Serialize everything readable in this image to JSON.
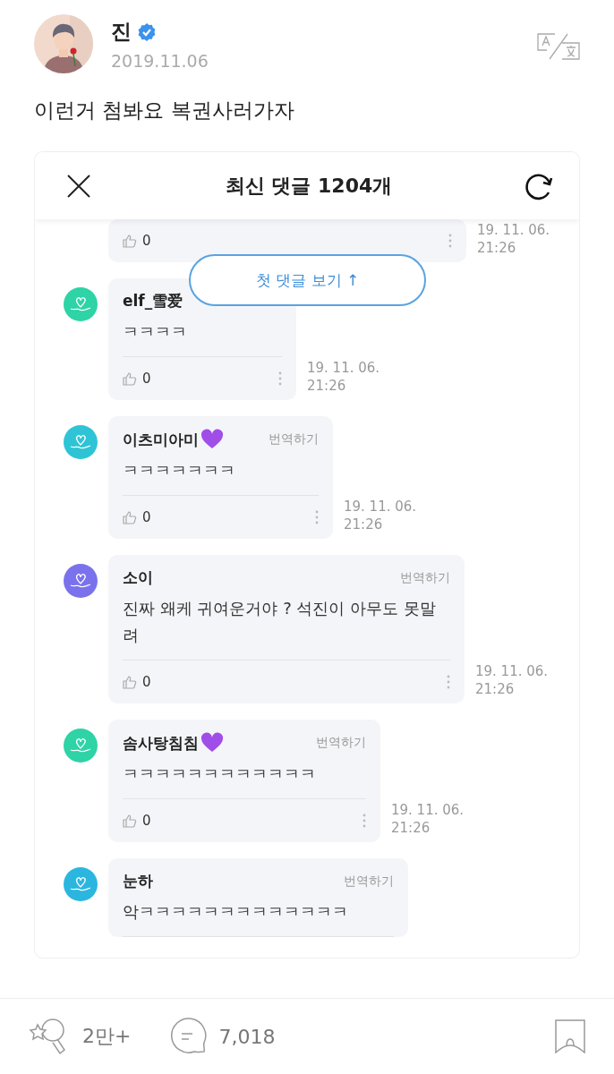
{
  "post": {
    "author": "진",
    "verified": true,
    "date": "2019.11.06",
    "text": "이런거 첨봐요 복권사러가자"
  },
  "comments_panel": {
    "title": "최신 댓글 1204개",
    "first_comment_button": "첫 댓글 보기 ↑",
    "comments": [
      {
        "kind": "partial",
        "likes": "0",
        "time": [
          "19. 11. 06.",
          "21:26"
        ]
      },
      {
        "kind": "full",
        "name": "elf_雪爱",
        "heart": false,
        "color": "#2ed3a6",
        "text": "ㅋㅋㅋㅋ",
        "likes": "0",
        "time": [
          "19. 11. 06.",
          "21:26"
        ]
      },
      {
        "kind": "full",
        "name": "이츠미아미",
        "heart": true,
        "color": "#2ec4d6",
        "translate": "번역하기",
        "text": "ㅋㅋㅋㅋㅋㅋㅋ",
        "likes": "0",
        "time": [
          "19. 11. 06.",
          "21:26"
        ]
      },
      {
        "kind": "full",
        "name": "소이",
        "heart": false,
        "color": "#7a72ec",
        "translate": "번역하기",
        "text": "진짜 왜케 귀여운거야 ? 석진이 아무도 못말려",
        "likes": "0",
        "time": [
          "19. 11. 06.",
          "21:26"
        ]
      },
      {
        "kind": "full",
        "name": "솜사탕침침",
        "heart": true,
        "color": "#2ed3a6",
        "translate": "번역하기",
        "text": "ㅋㅋㅋㅋㅋㅋㅋㅋㅋㅋㅋㅋ",
        "likes": "0",
        "time": [
          "19. 11. 06.",
          "21:26"
        ]
      },
      {
        "kind": "cut",
        "name": "눈하",
        "heart": false,
        "color": "#2bb6e0",
        "translate": "번역하기",
        "text": "악ㅋㅋㅋㅋㅋㅋㅋㅋㅋㅋㅋㅋㅋ"
      }
    ]
  },
  "footer": {
    "lightstick_count": "2만+",
    "comment_count": "7,018"
  }
}
